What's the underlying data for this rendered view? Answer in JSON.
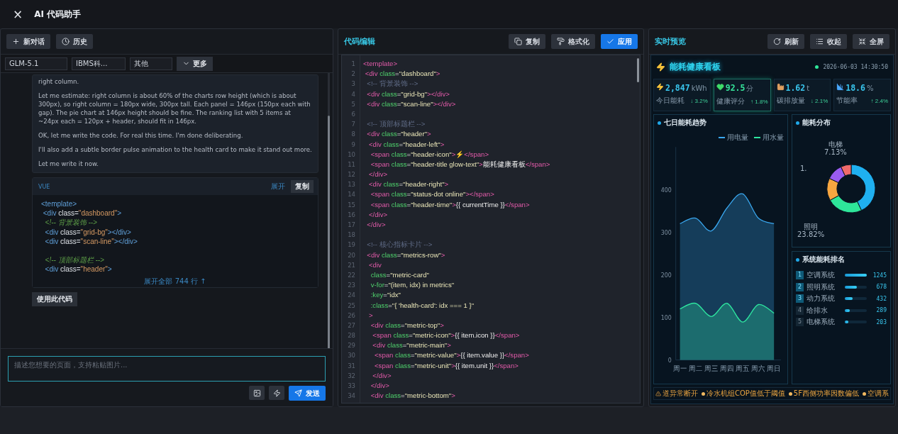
{
  "window": {
    "title": "AI 代码助手",
    "close": "×"
  },
  "chat": {
    "toolbar": [
      {
        "kind": "new",
        "label": "新对话"
      },
      {
        "kind": "history",
        "label": "历史"
      }
    ],
    "selects": [
      {
        "value": "GLM-5.1"
      },
      {
        "value": "IBMS科..."
      },
      {
        "value": "其他"
      }
    ],
    "more": "更多",
    "message": [
      "right column.",
      "Let me estimate: right column is about 60% of the charts row height (which is about 300px), so right column = 180px wide, 300px tall. Each panel = 146px (150px each with gap). The pie chart at 146px height should be fine. The ranking list with 5 items at ~24px each = 120px + header, should fit in 146px.",
      "OK, let me write the code. For real this time. I'm done deliberating.",
      "I'll also add a subtle border pulse animation to the health card to make it stand out more.",
      "Let me write it now."
    ],
    "code_block": {
      "lang": "VUE",
      "expand": "展开",
      "copy": "复制",
      "sections": [
        [
          "<template>",
          " <div class=\"dashboard\">",
          "  <!-- 背景装饰 -->",
          "  <div class=\"grid-bg\"></div>",
          "  <div class=\"scan-line\"></div>"
        ],
        [
          "  <!-- 顶部标题栏 -->",
          "  <div class=\"header\">"
        ]
      ],
      "footer": "展开全部 744 行 ↑"
    },
    "use_code": "使用此代码",
    "input": {
      "placeholder": "描述您想要的页面，支持粘贴图片..."
    },
    "send": "发送"
  },
  "editor": {
    "title": "代码编辑",
    "buttons": [
      {
        "kind": "copy",
        "label": "复制",
        "primary": false
      },
      {
        "kind": "format",
        "label": "格式化",
        "primary": false
      },
      {
        "kind": "apply",
        "label": "应用",
        "primary": true
      }
    ],
    "lines": [
      {
        "n": "1",
        "code": "<template>"
      },
      {
        "n": "2",
        "code": " <div class=\"dashboard\">"
      },
      {
        "n": "3",
        "code": "  <!-- 背景装饰 -->"
      },
      {
        "n": "4",
        "code": "  <div class=\"grid-bg\"></div>"
      },
      {
        "n": "5",
        "code": "  <div class=\"scan-line\"></div>"
      },
      {
        "n": "6"
      },
      {
        "n": "7",
        "code": "  <!-- 顶部标题栏 -->"
      },
      {
        "n": "8",
        "code": "  <div class=\"header\">"
      },
      {
        "n": "9",
        "code": "   <div class=\"header-left\">"
      },
      {
        "n": "10",
        "code": "    <span class=\"header-icon\">⚡</span>"
      },
      {
        "n": "11",
        "code": "    <span class=\"header-title glow-text\">能耗健康看板</span>"
      },
      {
        "n": "12",
        "code": "   </div>"
      },
      {
        "n": "13",
        "code": "   <div class=\"header-right\">"
      },
      {
        "n": "14",
        "code": "    <span class=\"status-dot online\"></span>"
      },
      {
        "n": "15",
        "code": "    <span class=\"header-time\">{{ currentTime }}</span>"
      },
      {
        "n": "16",
        "code": "   </div>"
      },
      {
        "n": "17",
        "code": "  </div>"
      },
      {
        "n": "18"
      },
      {
        "n": "19",
        "code": "  <!-- 核心指标卡片 -->"
      },
      {
        "n": "20",
        "code": "  <div class=\"metrics-row\">"
      },
      {
        "n": "21",
        "code": "   <div"
      },
      {
        "n": "22",
        "code": "    class=\"metric-card\""
      },
      {
        "n": "23",
        "code": "    v-for=\"(item, idx) in metrics\""
      },
      {
        "n": "24",
        "code": "    :key=\"idx\""
      },
      {
        "n": "25",
        "code": "    :class=\"{ 'health-card': idx === 1 }\""
      },
      {
        "n": "26",
        "code": "   >"
      },
      {
        "n": "27",
        "code": "    <div class=\"metric-top\">"
      },
      {
        "n": "28",
        "code": "     <span class=\"metric-icon\">{{ item.icon }}</span>"
      },
      {
        "n": "29",
        "code": "     <div class=\"metric-main\">"
      },
      {
        "n": "30",
        "code": "      <span class=\"metric-value\">{{ item.value }}</span>"
      },
      {
        "n": "31",
        "code": "      <span class=\"metric-unit\">{{ item.unit }}</span>"
      },
      {
        "n": "32",
        "code": "     </div>"
      },
      {
        "n": "33",
        "code": "    </div>"
      },
      {
        "n": "34",
        "code": "    <div class=\"metric-bottom\">"
      }
    ]
  },
  "preview": {
    "title": "实时预览",
    "buttons": [
      {
        "kind": "refresh",
        "label": "刷新"
      },
      {
        "kind": "collapse",
        "label": "收起"
      },
      {
        "kind": "fullscreen",
        "label": "全屏"
      }
    ],
    "dashboard": {
      "title": "能耗健康看板",
      "time": "2026-06-03 14:30:50",
      "metrics": [
        {
          "kind": "energy",
          "value": "2,847",
          "unit": "kWh",
          "label": "今日能耗",
          "change": "↓ 3.2%",
          "highlighted": false
        },
        {
          "kind": "health",
          "value": "92.5",
          "unit": "分",
          "label": "健康评分",
          "change": "↑ 1.8%",
          "highlighted": true
        },
        {
          "kind": "carbon",
          "value": "1.62",
          "unit": "t",
          "label": "碳排放量",
          "change": "↓ 2.1%",
          "highlighted": false
        },
        {
          "kind": "saving",
          "value": "18.6",
          "unit": "%",
          "label": "节能率",
          "change": "↑ 2.4%",
          "highlighted": false
        }
      ],
      "trend": {
        "chart_data": {
          "type": "area",
          "title": "七日能耗趋势",
          "categories": [
            "周一",
            "周二",
            "周三",
            "周四",
            "周五",
            "周六",
            "周日"
          ],
          "series": [
            {
              "name": "用电量",
              "color": "#3aa8f0",
              "values": [
                320,
                333,
                303,
                357,
                390,
                333,
                320
              ]
            },
            {
              "name": "用水量",
              "color": "#2ee6a0",
              "values": [
                120,
                133,
                102,
                133,
                89,
                130,
                110
              ]
            }
          ],
          "ylim": [
            0,
            500
          ],
          "yticks": [
            0,
            100,
            200,
            300,
            400
          ]
        }
      },
      "distribution": {
        "title": "能耗分布",
        "labels": [
          {
            "name": "电梯",
            "pct": "7.13%"
          },
          {
            "pct": "1."
          },
          {
            "name": "照明",
            "pct": "23.82%"
          }
        ]
      },
      "ranking": {
        "title": "系统能耗排名",
        "items": [
          {
            "rank": "1",
            "name": "空调系统",
            "value": "1245",
            "level": 1.0,
            "top": true
          },
          {
            "rank": "2",
            "name": "照明系统",
            "value": "678",
            "level": 0.54,
            "top": true
          },
          {
            "rank": "3",
            "name": "动力系统",
            "value": "432",
            "level": 0.35,
            "top": true
          },
          {
            "rank": "4",
            "name": "给排水",
            "value": "289",
            "level": 0.23,
            "top": false
          },
          {
            "rank": "5",
            "name": "电梯系统",
            "value": "203",
            "level": 0.16,
            "top": false
          }
        ]
      },
      "alerts": [
        {
          "kind": "warning",
          "text": "道异常断开"
        },
        {
          "kind": "dot",
          "text": "冷水机组COP值低于阈值"
        },
        {
          "kind": "dot",
          "text": "5F西侧功率因数偏低"
        },
        {
          "kind": "dot",
          "text": "空调系"
        }
      ]
    }
  }
}
